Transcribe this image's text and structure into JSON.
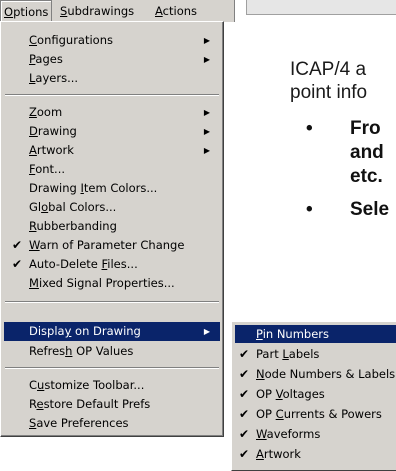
{
  "menubar": {
    "items": [
      {
        "label": "Options",
        "mnemonic": "O",
        "rest": "ptions"
      },
      {
        "label": "Subdrawings",
        "mnemonic": "S",
        "rest": "ubdrawings"
      },
      {
        "label": "Actions",
        "mnemonic": "A",
        "rest": "ctions"
      }
    ]
  },
  "options_menu": {
    "configurations": {
      "pre": "",
      "mn": "C",
      "post": "onfigurations"
    },
    "pages": {
      "pre": "",
      "mn": "P",
      "post": "ages"
    },
    "layers": {
      "pre": "",
      "mn": "L",
      "post": "ayers..."
    },
    "zoom": {
      "pre": "",
      "mn": "Z",
      "post": "oom"
    },
    "drawing": {
      "pre": "",
      "mn": "D",
      "post": "rawing"
    },
    "artwork": {
      "pre": "",
      "mn": "A",
      "post": "rtwork"
    },
    "font": {
      "pre": "",
      "mn": "F",
      "post": "ont..."
    },
    "drawing_item_colors": {
      "pre": "Drawing ",
      "mn": "I",
      "post": "tem Colors..."
    },
    "global_colors": {
      "pre": "Gl",
      "mn": "o",
      "post": "bal Colors..."
    },
    "rubberbanding": {
      "pre": "",
      "mn": "R",
      "post": "ubberbanding"
    },
    "warn_param_change": {
      "pre": "",
      "mn": "W",
      "post": "arn of Parameter Change"
    },
    "auto_delete_files": {
      "pre": "Auto-Delete ",
      "mn": "F",
      "post": "iles..."
    },
    "mixed_signal": {
      "pre": "",
      "mn": "M",
      "post": "ixed Signal Properties..."
    },
    "display_on_drawing": {
      "pre": "Displa",
      "mn": "y",
      "post": " on Drawing"
    },
    "refresh_op": {
      "pre": "Refres",
      "mn": "h",
      "post": " OP Values"
    },
    "customize_toolbar": {
      "pre": "C",
      "mn": "u",
      "post": "stomize Toolbar..."
    },
    "restore_prefs": {
      "pre": "R",
      "mn": "e",
      "post": "store Default Prefs"
    },
    "save_prefs": {
      "pre": "",
      "mn": "S",
      "post": "ave Preferences"
    }
  },
  "display_submenu": {
    "pin_numbers": {
      "pre": "",
      "mn": "P",
      "post": "in Numbers"
    },
    "part_labels": {
      "pre": "Part ",
      "mn": "L",
      "post": "abels"
    },
    "node_numbers": {
      "pre": "",
      "mn": "N",
      "post": "ode Numbers & Labels"
    },
    "op_voltages": {
      "pre": "OP ",
      "mn": "V",
      "post": "oltages"
    },
    "op_currents": {
      "pre": "OP ",
      "mn": "C",
      "post": "urrents & Powers"
    },
    "waveforms": {
      "pre": "",
      "mn": "W",
      "post": "aveforms"
    },
    "artwork": {
      "pre": "",
      "mn": "A",
      "post": "rtwork"
    }
  },
  "glyphs": {
    "arrow": "▶",
    "check": "✔",
    "bullet": "•"
  },
  "document": {
    "line1": "ICAP/4 a",
    "line2": "point info",
    "bullet1_line1": "Fro",
    "bullet1_line2": "and",
    "bullet1_line3": "etc.",
    "bullet2_line1": "Sele"
  },
  "colors": {
    "menu_bg": "#d6d3ce",
    "highlight": "#0a246a",
    "highlight_text": "#ffffff"
  }
}
